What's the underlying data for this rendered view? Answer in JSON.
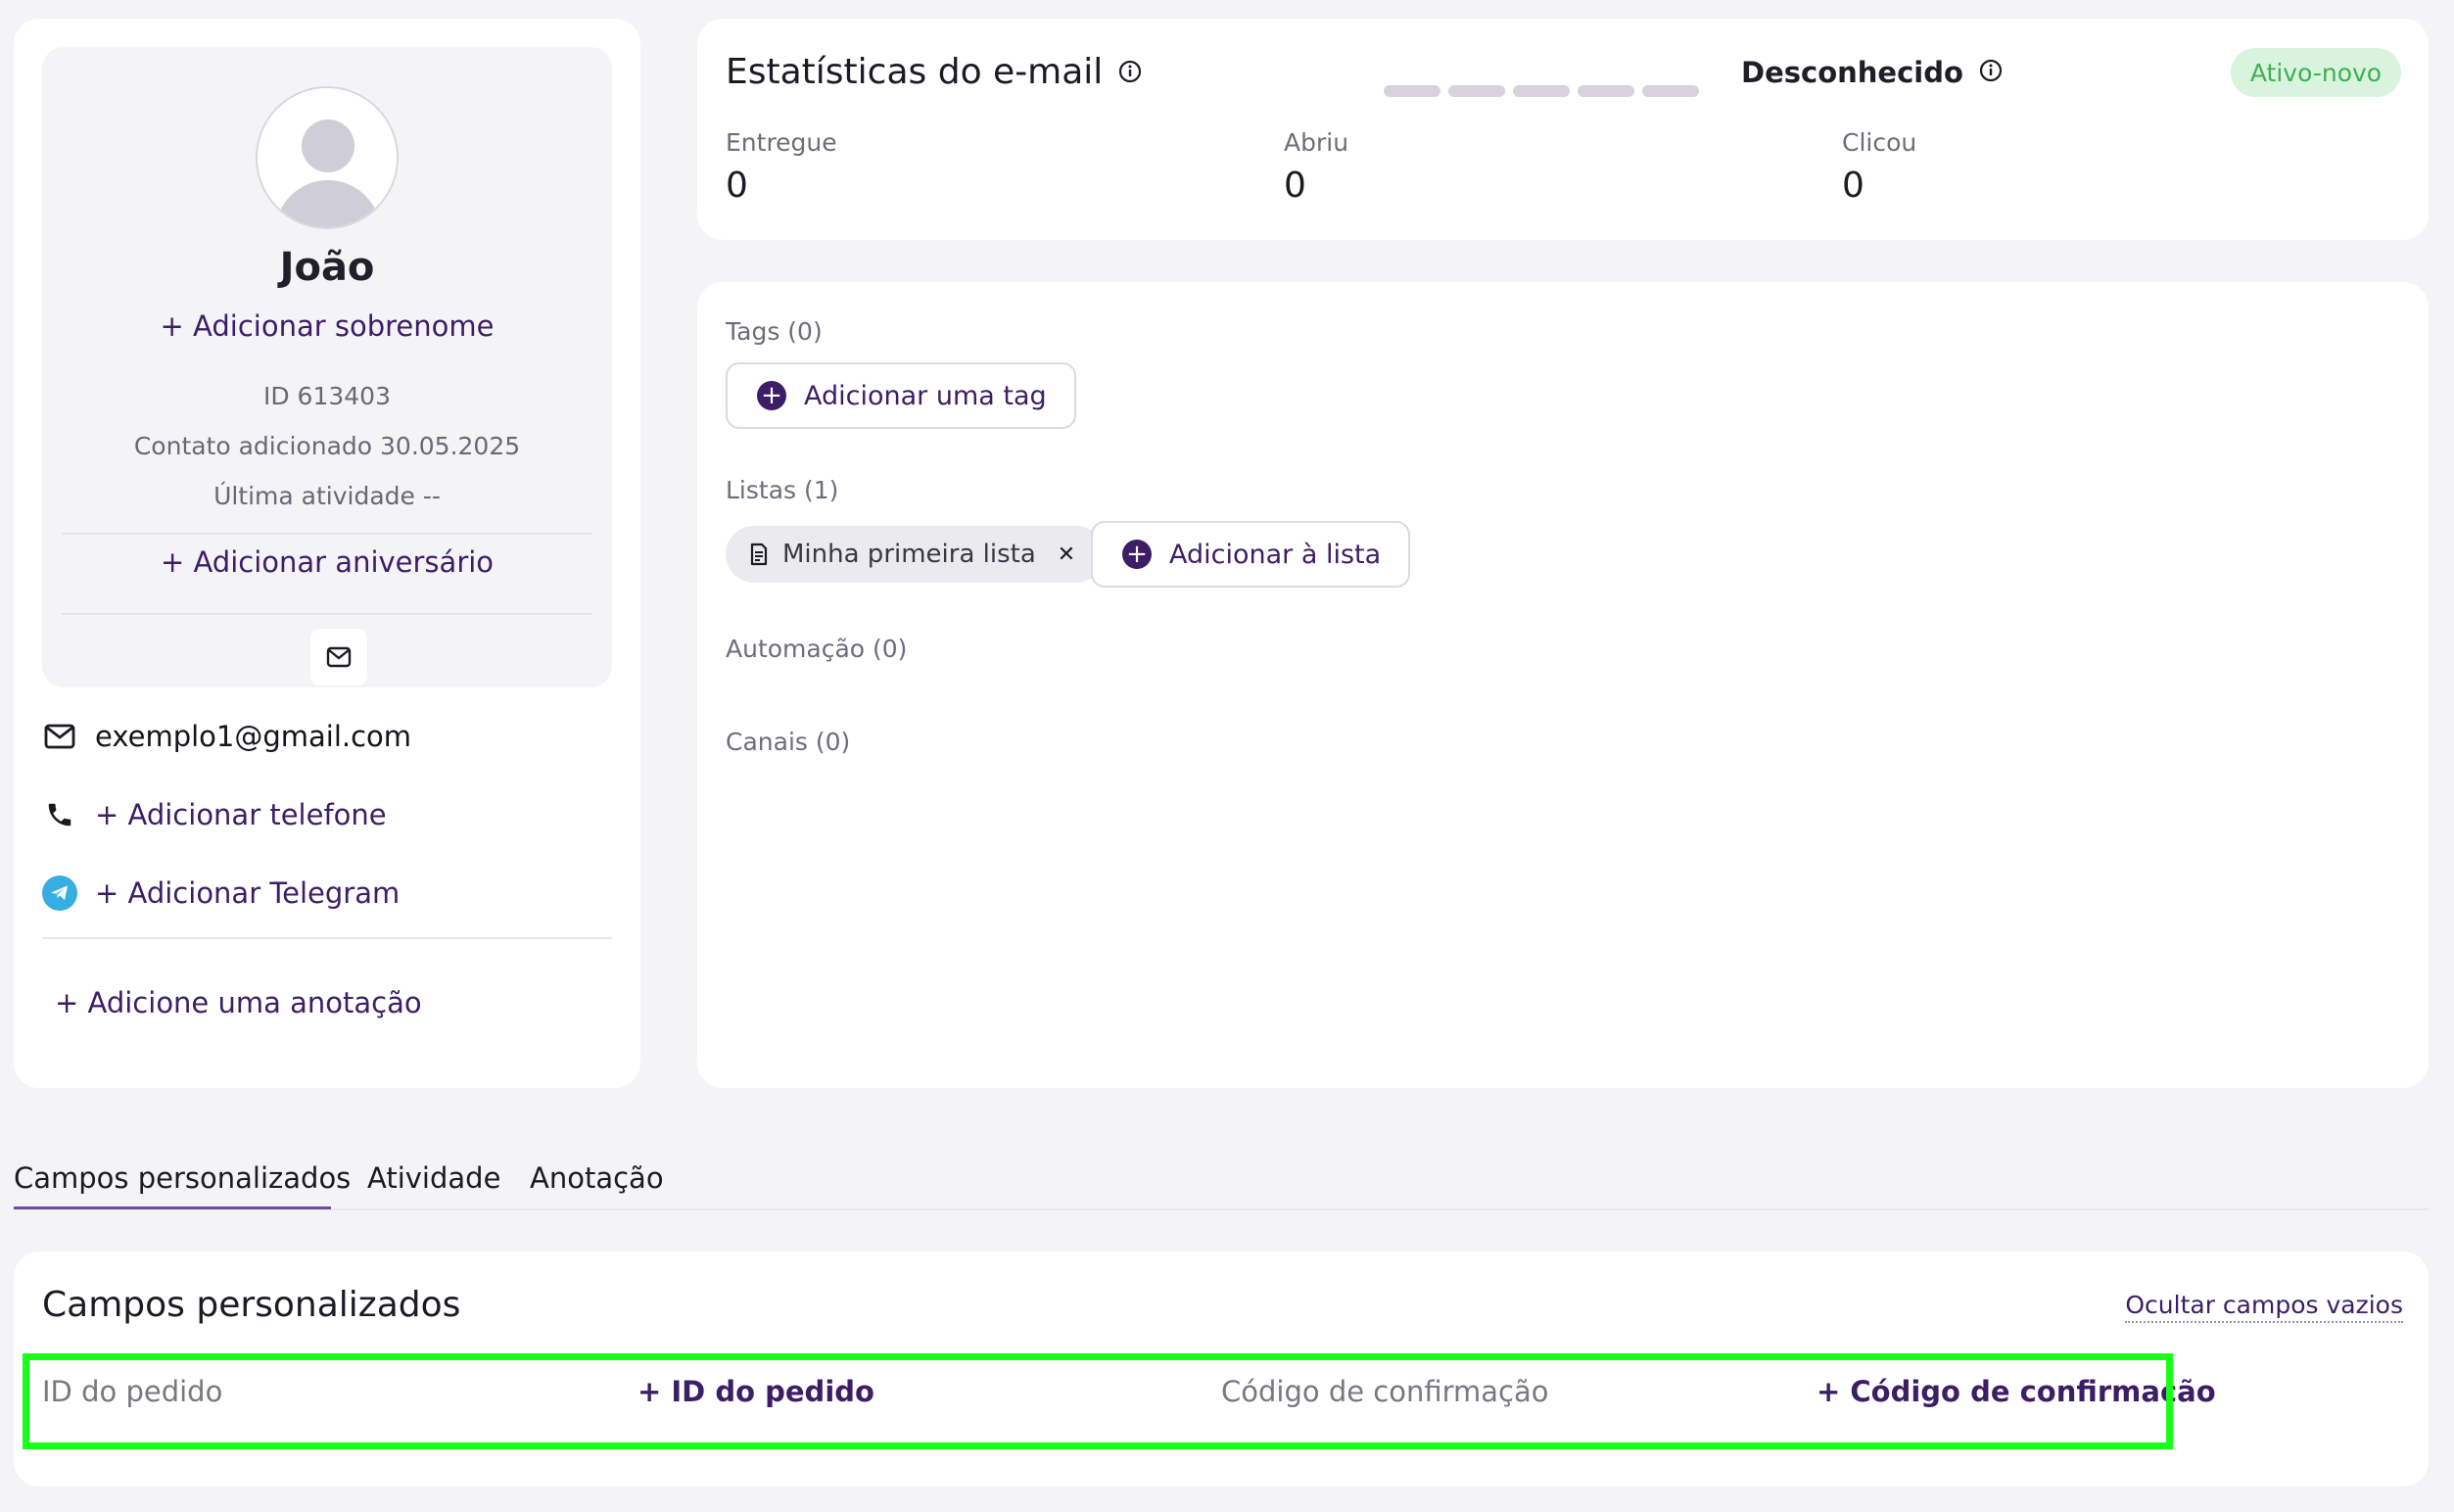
{
  "profile": {
    "name": "João",
    "add_surname": "+ Adicionar sobrenome",
    "id_text": "ID 613403",
    "added_text": "Contato adicionado 30.05.2025",
    "last_activity": "Última atividade --",
    "add_birthday": "+ Adicionar aniversário",
    "email": "exemplo1@gmail.com",
    "add_phone": "+ Adicionar telefone",
    "add_telegram": "+ Adicionar Telegram",
    "add_note": "+ Adicione uma anotação"
  },
  "stats": {
    "title": "Estatísticas do e-mail",
    "status_unknown": "Desconhecido",
    "status_badge": "Ativo-novo",
    "items": [
      {
        "label": "Entregue",
        "value": "0"
      },
      {
        "label": "Abriu",
        "value": "0"
      },
      {
        "label": "Clicou",
        "value": "0"
      }
    ]
  },
  "tags_section": {
    "tags_label": "Tags (0)",
    "add_tag": "Adicionar uma tag",
    "lists_label": "Listas (1)",
    "lists": [
      "Minha primeira lista"
    ],
    "add_to_list": "Adicionar à lista",
    "automation_label": "Automação (0)",
    "channels_label": "Canais (0)"
  },
  "tabs": [
    "Campos personalizados",
    "Atividade",
    "Anotação"
  ],
  "custom_fields": {
    "title": "Campos personalizados",
    "hide_empty": "Ocultar campos vazios",
    "fields": [
      {
        "label": "ID do pedido",
        "add": "+ ID do pedido"
      },
      {
        "label": "Código de confirmação",
        "add": "+ Código de confirmação"
      }
    ]
  },
  "colors": {
    "accent": "#3d1d66",
    "badge_bg": "#d9f4dc",
    "badge_text": "#3fae57",
    "highlight": "#1aff1a",
    "telegram": "#37aee2"
  }
}
